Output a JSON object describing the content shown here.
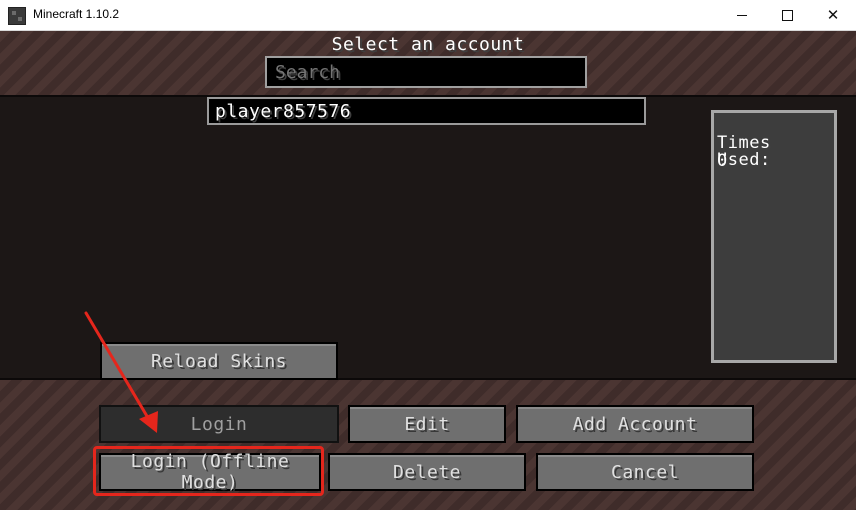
{
  "window": {
    "title": "Minecraft 1.10.2",
    "controls": [
      "minimize-icon",
      "maximize-icon",
      "close-icon"
    ]
  },
  "screen": {
    "heading": "Select an account",
    "search": {
      "value": "",
      "placeholder": "Search"
    },
    "accounts": [
      {
        "name": "player857576"
      }
    ],
    "info": {
      "label": "Times Used:",
      "value": "0"
    }
  },
  "buttons": {
    "reload_skins": "Reload Skins",
    "login": "Login",
    "edit": "Edit",
    "add_account": "Add Account",
    "login_offline": "Login (Offline Mode)",
    "delete": "Delete",
    "cancel": "Cancel"
  },
  "annotation": {
    "color": "#e5261c"
  }
}
